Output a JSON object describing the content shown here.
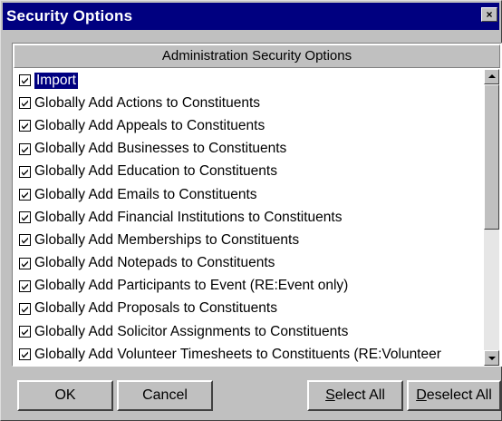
{
  "window": {
    "title": "Security Options",
    "close_glyph": "×"
  },
  "list": {
    "header": "Administration Security Options",
    "items": [
      {
        "label": "Import",
        "checked": true,
        "selected": true
      },
      {
        "label": "Globally Add Actions to Constituents",
        "checked": true
      },
      {
        "label": "Globally Add Appeals to Constituents",
        "checked": true
      },
      {
        "label": "Globally Add Businesses to Constituents",
        "checked": true
      },
      {
        "label": "Globally Add Education to Constituents",
        "checked": true
      },
      {
        "label": "Globally Add Emails to Constituents",
        "checked": true
      },
      {
        "label": "Globally Add Financial Institutions to Constituents",
        "checked": true
      },
      {
        "label": "Globally Add Memberships to Constituents",
        "checked": true
      },
      {
        "label": "Globally Add Notepads to Constituents",
        "checked": true
      },
      {
        "label": "Globally Add Participants to Event (RE:Event only)",
        "checked": true
      },
      {
        "label": "Globally Add Proposals to Constituents",
        "checked": true
      },
      {
        "label": "Globally Add Solicitor Assignments to Constituents",
        "checked": true
      },
      {
        "label": "Globally Add Volunteer Timesheets to Constituents (RE:Volunteer",
        "checked": true
      }
    ]
  },
  "buttons": {
    "ok": "OK",
    "cancel": "Cancel",
    "select_all_mnemonic": "S",
    "select_all_rest": "elect All",
    "deselect_all_mnemonic": "D",
    "deselect_all_rest": "eselect All"
  },
  "colors": {
    "titlebar": "#000080",
    "selection": "#000080",
    "face": "#c0c0c0"
  },
  "icons": {
    "close": "close-icon",
    "checkbox": "checkmark-icon",
    "scroll_up": "arrow-up-icon",
    "scroll_down": "arrow-down-icon"
  }
}
